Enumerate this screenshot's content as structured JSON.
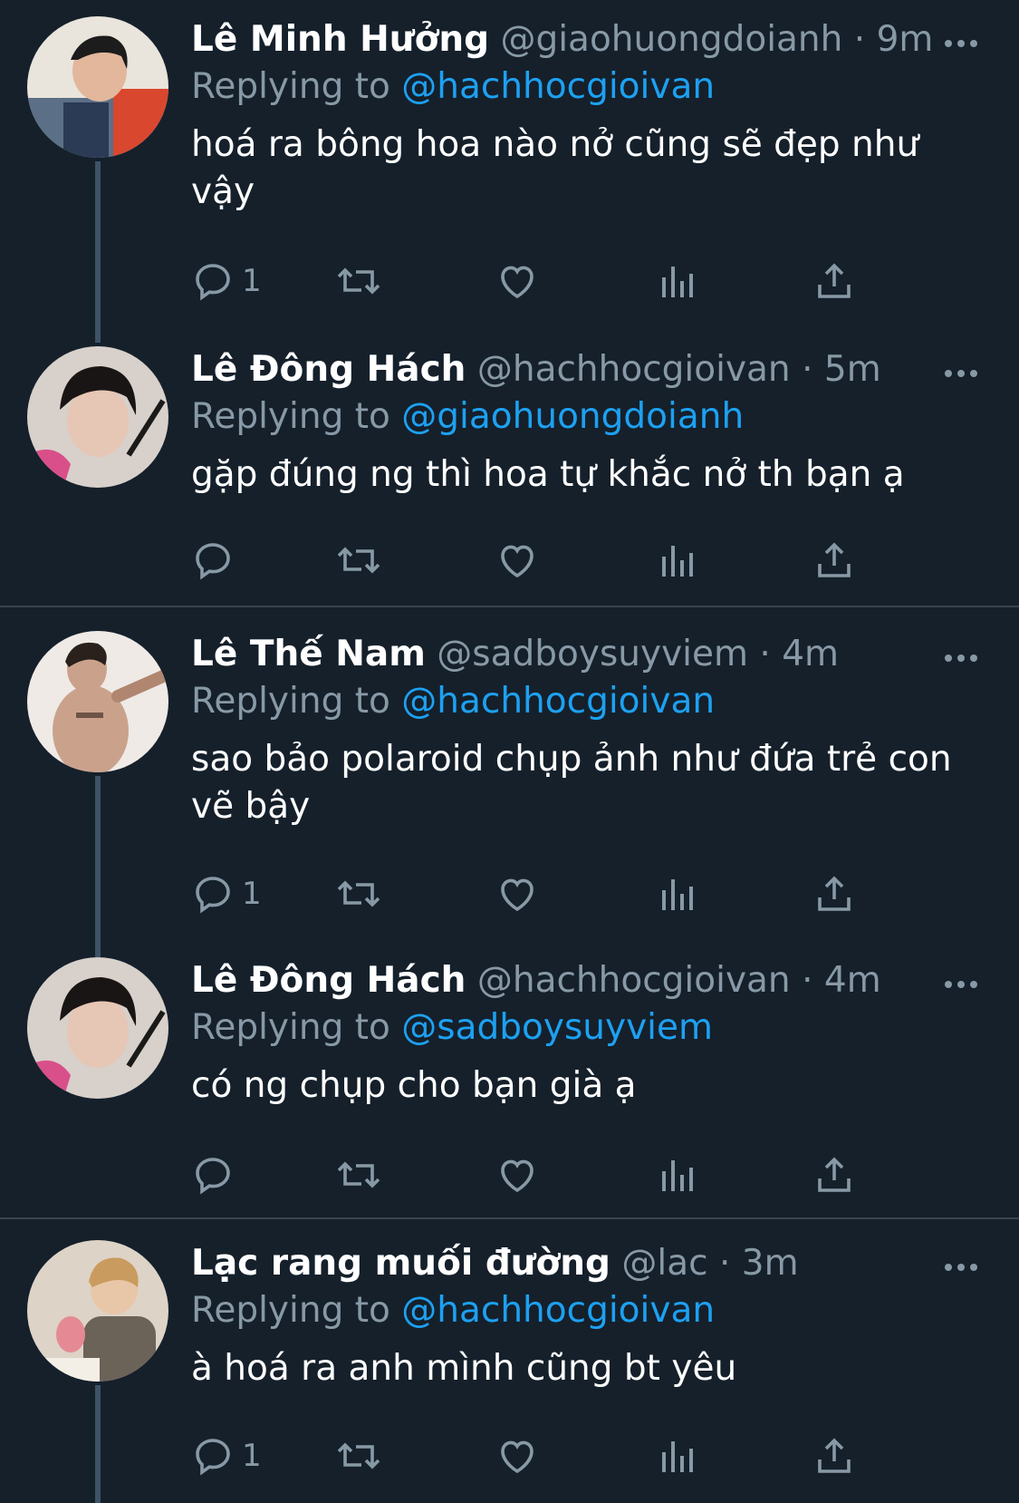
{
  "colors": {
    "background": "#15202b",
    "name": "#ffffff",
    "secondary_text": "#8899a6",
    "mention": "#1da1f2",
    "thread_line": "#3d5466",
    "divider": "#38444d"
  },
  "tweets": [
    {
      "name": "Lê Minh Hưởng",
      "handle": "@giaohuongdoianh",
      "time": "9m",
      "replying_label": "Replying to",
      "replying_to": "@hachhocgioivan",
      "text": "hoá ra bông hoa nào nở cũng sẽ đẹp như vậy",
      "reply_count": "1",
      "avatar_icon": "avatar-photo-icon"
    },
    {
      "name": "Lê Đông Hách",
      "handle": "@hachhocgioivan",
      "time": "5m",
      "replying_label": "Replying to",
      "replying_to": "@giaohuongdoianh",
      "text": "gặp đúng ng thì hoa tự khắc nở th bạn ạ",
      "reply_count": "",
      "avatar_icon": "avatar-photo-icon"
    },
    {
      "name": "Lê Thế Nam",
      "handle": "@sadboysuyviem",
      "time": "4m",
      "replying_label": "Replying to",
      "replying_to": "@hachhocgioivan",
      "text": "sao bảo polaroid chụp ảnh như đứa trẻ con vẽ bậy",
      "reply_count": "1",
      "avatar_icon": "avatar-photo-icon"
    },
    {
      "name": "Lê Đông Hách",
      "handle": "@hachhocgioivan",
      "time": "4m",
      "replying_label": "Replying to",
      "replying_to": "@sadboysuyviem",
      "text": "có ng chụp cho bạn già ạ",
      "reply_count": "",
      "avatar_icon": "avatar-photo-icon"
    },
    {
      "name": "Lạc rang muối đường",
      "handle": "@lac",
      "time": "3m",
      "replying_label": "Replying to",
      "replying_to": "@hachhocgioivan",
      "text": "à hoá ra anh mình cũng bt yêu",
      "reply_count": "1",
      "avatar_icon": "avatar-photo-icon"
    }
  ],
  "separator": "·",
  "action_icons": [
    "reply-icon",
    "retweet-icon",
    "like-icon",
    "analytics-icon",
    "share-icon"
  ]
}
